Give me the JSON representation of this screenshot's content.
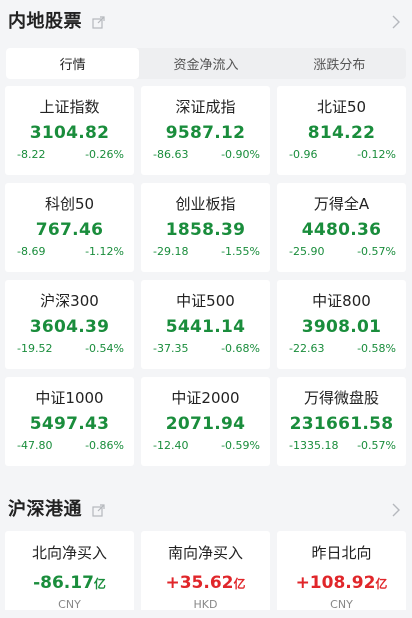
{
  "mainland": {
    "title": "内地股票",
    "tabs": [
      {
        "label": "行情",
        "active": true
      },
      {
        "label": "资金净流入",
        "active": false
      },
      {
        "label": "涨跌分布",
        "active": false
      }
    ],
    "indices": [
      {
        "name": "上证指数",
        "value": "3104.82",
        "change": "-8.22",
        "pct": "-0.26%"
      },
      {
        "name": "深证成指",
        "value": "9587.12",
        "change": "-86.63",
        "pct": "-0.90%"
      },
      {
        "name": "北证50",
        "value": "814.22",
        "change": "-0.96",
        "pct": "-0.12%"
      },
      {
        "name": "科创50",
        "value": "767.46",
        "change": "-8.69",
        "pct": "-1.12%"
      },
      {
        "name": "创业板指",
        "value": "1858.39",
        "change": "-29.18",
        "pct": "-1.55%"
      },
      {
        "name": "万得全A",
        "value": "4480.36",
        "change": "-25.90",
        "pct": "-0.57%"
      },
      {
        "name": "沪深300",
        "value": "3604.39",
        "change": "-19.52",
        "pct": "-0.54%"
      },
      {
        "name": "中证500",
        "value": "5441.14",
        "change": "-37.35",
        "pct": "-0.68%"
      },
      {
        "name": "中证800",
        "value": "3908.01",
        "change": "-22.63",
        "pct": "-0.58%"
      },
      {
        "name": "中证1000",
        "value": "5497.43",
        "change": "-47.80",
        "pct": "-0.86%"
      },
      {
        "name": "中证2000",
        "value": "2071.94",
        "change": "-12.40",
        "pct": "-0.59%"
      },
      {
        "name": "万得微盘股",
        "value": "231661.58",
        "change": "-1335.18",
        "pct": "-0.57%"
      }
    ]
  },
  "connect": {
    "title": "沪深港通",
    "flows": [
      {
        "name": "北向净买入",
        "value": "-86.17",
        "unit": "亿",
        "currency": "CNY",
        "direction": "down"
      },
      {
        "name": "南向净买入",
        "value": "+35.62",
        "unit": "亿",
        "currency": "HKD",
        "direction": "up"
      },
      {
        "name": "昨日北向",
        "value": "+108.92",
        "unit": "亿",
        "currency": "CNY",
        "direction": "up"
      }
    ]
  },
  "colors": {
    "down": "#1a8d3c",
    "up": "#e0262a",
    "background": "#f4f5f7",
    "card": "#ffffff"
  },
  "icons": [
    "share-icon",
    "chevron-right-icon"
  ]
}
